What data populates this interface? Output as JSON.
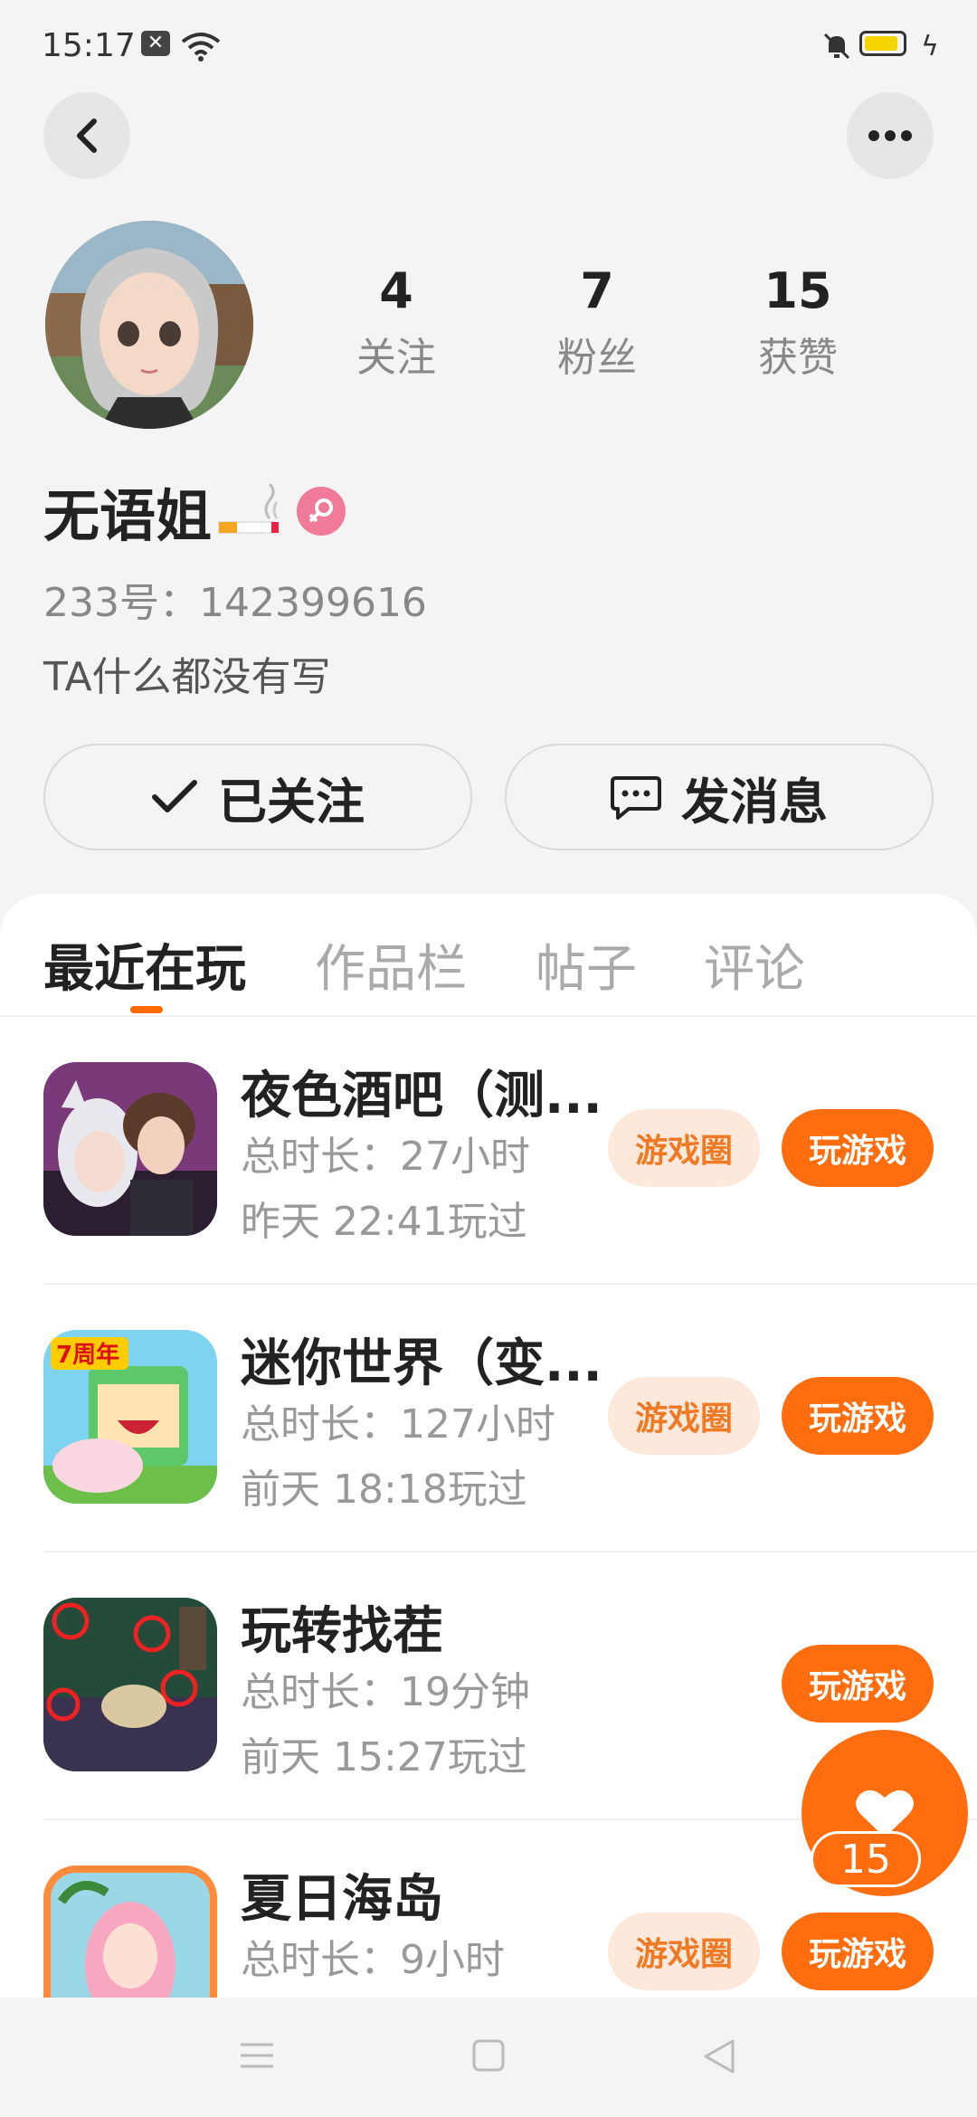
{
  "status_bar": {
    "time": "15:17"
  },
  "profile": {
    "stats": [
      {
        "value": "4",
        "label": "关注"
      },
      {
        "value": "7",
        "label": "粉丝"
      },
      {
        "value": "15",
        "label": "获赞"
      }
    ],
    "name": "无语姐",
    "uid": "233号：142399616",
    "bio": "TA什么都没有写"
  },
  "actions": {
    "follow_label": "已关注",
    "message_label": "发消息"
  },
  "tabs": [
    "最近在玩",
    "作品栏",
    "帖子",
    "评论"
  ],
  "games": [
    {
      "title": "夜色酒吧（测...",
      "duration": "总时长：27小时",
      "last_played": "昨天 22:41玩过",
      "circle_label": "游戏圈",
      "play_label": "玩游戏"
    },
    {
      "title": "迷你世界（变...",
      "duration": "总时长：127小时",
      "last_played": "前天 18:18玩过",
      "circle_label": "游戏圈",
      "play_label": "玩游戏"
    },
    {
      "title": "玩转找茬",
      "duration": "总时长：19分钟",
      "last_played": "前天 15:27玩过",
      "play_label": "玩游戏"
    },
    {
      "title": "夏日海岛",
      "duration": "总时长：9小时",
      "last_played": "",
      "circle_label": "游戏圈",
      "play_label": "玩游戏"
    }
  ],
  "like_fab": {
    "count": "15"
  },
  "colors": {
    "accent": "#ff6d0e",
    "circle_tag_bg": "#fde9dc",
    "circle_tag_text": "#f07a24",
    "gender_badge": "#f27a99"
  },
  "icons": [
    "back-arrow-icon",
    "more-dots-icon",
    "checkmark-icon",
    "chat-bubble-icon",
    "heart-icon",
    "female-icon",
    "menu-icon",
    "home-square-icon",
    "back-triangle-icon"
  ]
}
